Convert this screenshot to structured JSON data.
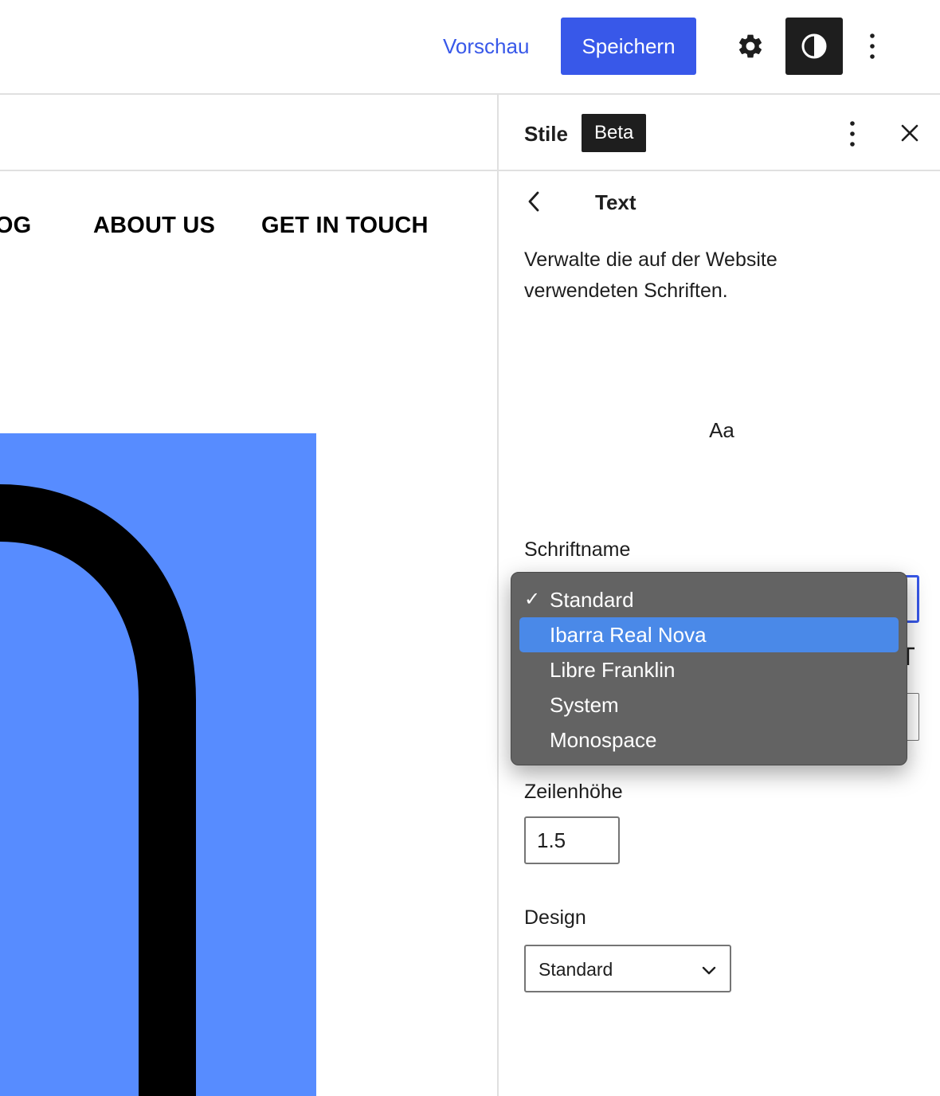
{
  "topbar": {
    "preview_label": "Vorschau",
    "save_label": "Speichern"
  },
  "canvas": {
    "nav": [
      "LOG",
      "ABOUT US",
      "GET IN TOUCH"
    ],
    "hero_color": "#578cff"
  },
  "sidebar": {
    "title": "Stile",
    "badge": "Beta",
    "panel_title": "Text",
    "description": "Verwalte die auf der Website verwendeten Schriften.",
    "preview_text": "Aa",
    "font_name_label": "Schriftname",
    "line_height_label": "Zeilenhöhe",
    "line_height_value": "1.5",
    "design_label": "Design",
    "design_value": "Standard"
  },
  "font_dropdown": {
    "selected": "Standard",
    "highlighted": "Ibarra Real Nova",
    "check_glyph": "✓",
    "options": [
      "Standard",
      "Ibarra Real Nova",
      "Libre Franklin",
      "System",
      "Monospace"
    ]
  },
  "colors": {
    "accent": "#3858e9",
    "dark": "#1e1e1e",
    "dropdown_bg": "#636363",
    "dropdown_highlight": "#4a89e8"
  },
  "icons": [
    "gear-icon",
    "contrast-icon",
    "more-vertical-icon",
    "close-icon",
    "chevron-left-icon",
    "chevron-down-icon"
  ]
}
